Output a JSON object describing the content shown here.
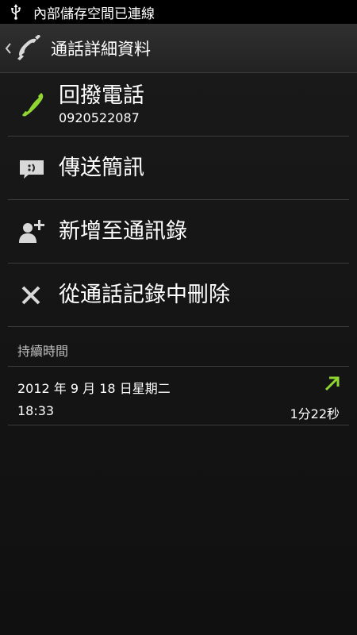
{
  "status_bar": {
    "notification_text": "內部儲存空間已連線"
  },
  "action_bar": {
    "title": "通話詳細資料"
  },
  "actions": [
    {
      "label": "回撥電話",
      "sub": "0920522087"
    },
    {
      "label": "傳送簡訊"
    },
    {
      "label": "新增至通訊錄"
    },
    {
      "label": "從通話記錄中刪除"
    }
  ],
  "section": {
    "header": "持續時間"
  },
  "call_entry": {
    "date": "2012 年 9 月 18 日星期二",
    "time": "18:33",
    "duration": "1分22秒"
  },
  "colors": {
    "accent_green": "#8fd630",
    "background": "#111111",
    "divider": "#3c3c3c"
  },
  "icons": {
    "status": "usb-icon",
    "back": "chevron-left-icon",
    "app": "phone-icon",
    "call_back": "phone-icon",
    "message": "message-icon",
    "add_contact": "add-contact-icon",
    "delete": "close-icon",
    "call_type": "outgoing-call-icon"
  }
}
